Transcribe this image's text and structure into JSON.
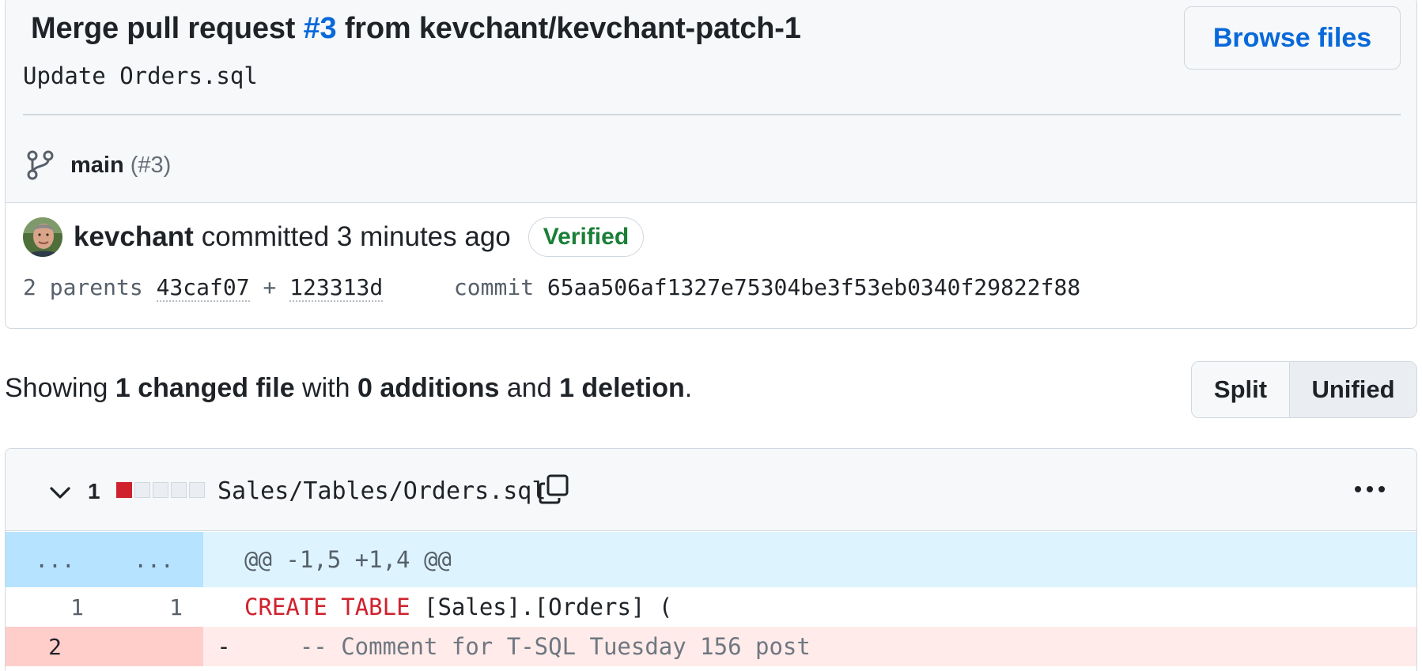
{
  "commit": {
    "title_prefix": "Merge pull request ",
    "title_link": "#3",
    "title_suffix": " from kevchant/kevchant-patch-1",
    "description": "Update Orders.sql",
    "browse_files_label": "Browse files",
    "branch": "main",
    "branch_pr": "(#3)",
    "author": "kevchant",
    "committed_text": "committed 3 minutes ago",
    "verified_label": "Verified",
    "parents_label": "2 parents",
    "parent1": "43caf07",
    "parent_sep": "+",
    "parent2": "123313d",
    "commit_label": "commit",
    "commit_sha": "65aa506af1327e75304be3f53eb0340f29822f88"
  },
  "summary": {
    "showing": "Showing ",
    "changed": "1 changed file",
    "with": " with ",
    "additions": "0 additions",
    "and": " and ",
    "deletions": "1 deletion",
    "end": "."
  },
  "view_toggle": {
    "split": "Split",
    "unified": "Unified",
    "selected": "Unified"
  },
  "file": {
    "change_count": "1",
    "path": "Sales/Tables/Orders.sql",
    "diffstat": [
      "deleted",
      "neutral",
      "neutral",
      "neutral",
      "neutral"
    ]
  },
  "diff": {
    "hunk_left": "...",
    "hunk_right": "...",
    "hunk_header": "@@ -1,5 +1,4 @@",
    "line1_old": "1",
    "line1_new": "1",
    "line1_kw1": "CREATE",
    "line1_kw2": "TABLE",
    "line1_rest": " [Sales].[Orders] (",
    "line2_old": "2",
    "line2_marker": "-",
    "line2_code": "    -- Comment for T-SQL Tuesday 156 post"
  },
  "colors": {
    "link": "#0969da",
    "verified": "#1a7f37",
    "deleted": "#cf222e",
    "hunk_bg": "#ddf4ff",
    "deletion_bg": "#ffebe9"
  }
}
